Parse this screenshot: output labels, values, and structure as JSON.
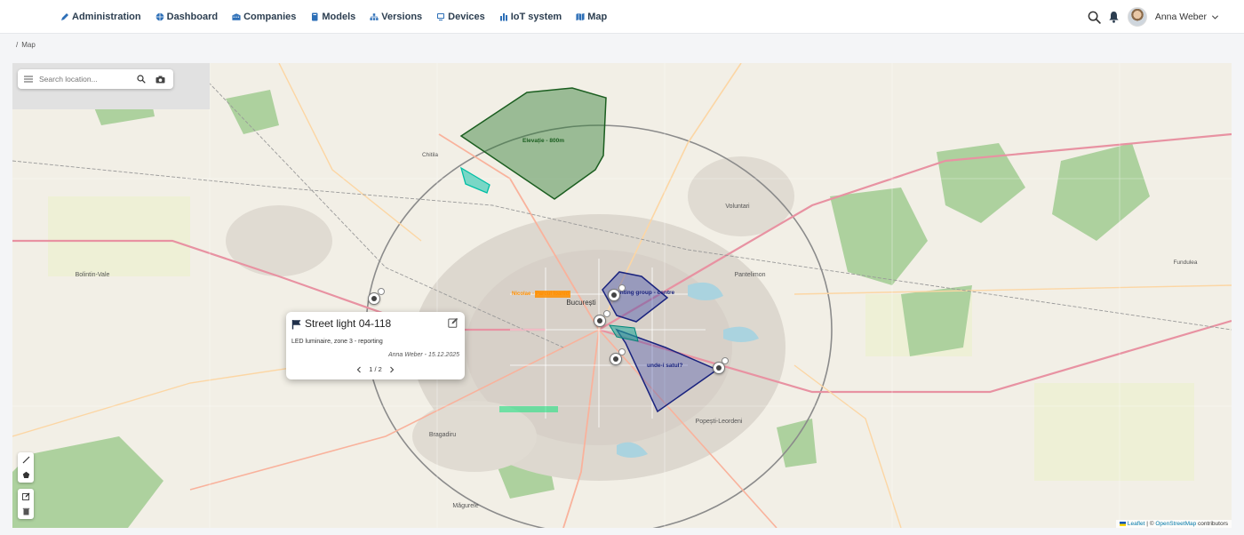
{
  "nav": {
    "items": [
      {
        "label": "Administration",
        "icon": "pencil-icon"
      },
      {
        "label": "Dashboard",
        "icon": "globe-icon"
      },
      {
        "label": "Companies",
        "icon": "building-icon"
      },
      {
        "label": "Models",
        "icon": "book-icon"
      },
      {
        "label": "Versions",
        "icon": "sitemap-icon"
      },
      {
        "label": "Devices",
        "icon": "monitor-icon"
      },
      {
        "label": "IoT system",
        "icon": "chart-bars-icon"
      },
      {
        "label": "Map",
        "icon": "map-icon"
      }
    ],
    "user_name": "Anna Weber"
  },
  "breadcrumb": {
    "separator": "/",
    "current": "Map"
  },
  "map": {
    "search_placeholder": "Search location...",
    "popup": {
      "title": "Street light 04-118",
      "description": "LED luminaire, zone 3 - reporting",
      "meta": "Anna Weber - 15.12.2025",
      "pager": "1 / 2"
    },
    "polygon_labels": {
      "north": "Elevație - 800m",
      "center": "Lighting group - centre",
      "south": "unde-i satul?",
      "orange": "Nicolae - Parcul Ioanid"
    },
    "attribution": {
      "leaflet": "Leaflet",
      "separator": " | © ",
      "osm": "OpenStreetMap",
      "suffix": " contributors"
    },
    "place_labels": [
      {
        "name": "Bolintin-Vale"
      },
      {
        "name": "Chitila"
      },
      {
        "name": "Voluntari"
      },
      {
        "name": "Pantelimon"
      },
      {
        "name": "București"
      },
      {
        "name": "Popești-Leordeni"
      },
      {
        "name": "Bragadiru"
      },
      {
        "name": "Măgurele"
      },
      {
        "name": "Fundulea"
      }
    ],
    "colors": {
      "polygon_north": "#2e7d32",
      "polygon_center": "#1a237e",
      "polygon_cyan": "#00bfa5",
      "polygon_orange": "#ff8f00"
    }
  }
}
